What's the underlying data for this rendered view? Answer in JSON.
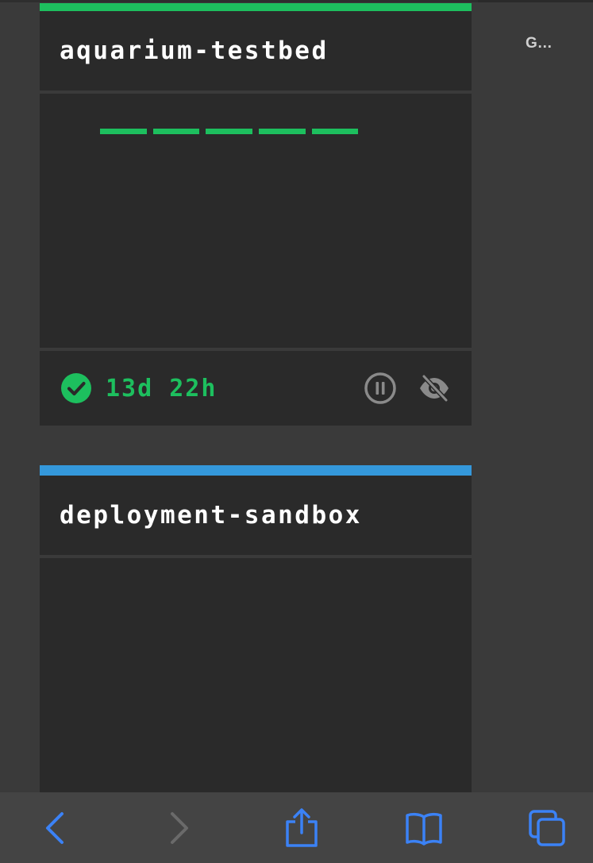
{
  "cards": [
    {
      "title": "aquarium-testbed",
      "accent_color": "#1dbf5e",
      "status": "running",
      "status_icon": "check-circle-icon",
      "uptime": "13d 22h",
      "actions": [
        {
          "name": "pause-icon"
        },
        {
          "name": "eye-off-icon"
        }
      ]
    },
    {
      "title": "deployment-sandbox",
      "accent_color": "#3498db"
    }
  ],
  "side_panel": {
    "label": "G…"
  },
  "browser_toolbar": {
    "items": [
      {
        "name": "back-icon",
        "enabled": true
      },
      {
        "name": "forward-icon",
        "enabled": false
      },
      {
        "name": "share-icon",
        "enabled": true
      },
      {
        "name": "bookmarks-icon",
        "enabled": true
      },
      {
        "name": "tabs-icon",
        "enabled": true
      }
    ],
    "accent_color": "#3b82f6"
  },
  "colors": {
    "background": "#3a3a3a",
    "card": "#2a2a2a",
    "success": "#1dbf5e",
    "info": "#3498db",
    "muted_icon": "#8a8a8a"
  }
}
